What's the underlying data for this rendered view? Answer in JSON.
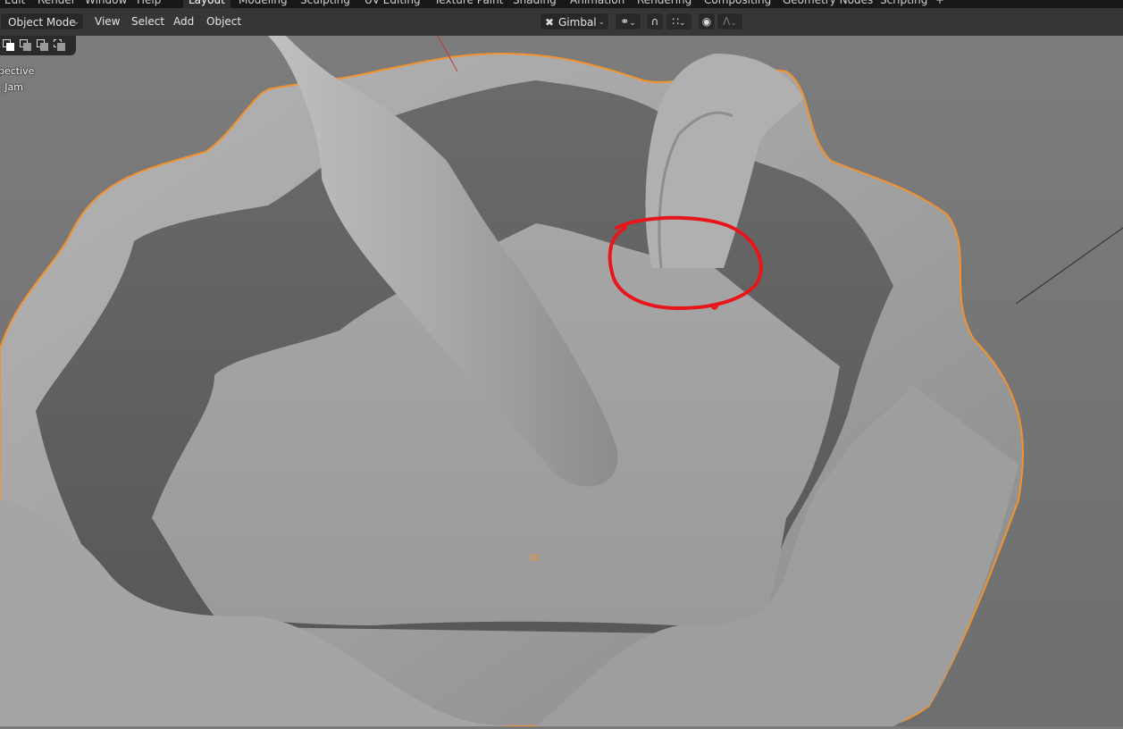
{
  "top_menu": [
    "Edit",
    "Render",
    "Window",
    "Help"
  ],
  "workspace_tabs": [
    {
      "label": "Layout",
      "active": true
    },
    {
      "label": "Modeling",
      "active": false
    },
    {
      "label": "Sculpting",
      "active": false
    },
    {
      "label": "UV Editing",
      "active": false
    },
    {
      "label": "Texture Paint",
      "active": false
    },
    {
      "label": "Shading",
      "active": false
    },
    {
      "label": "Animation",
      "active": false
    },
    {
      "label": "Rendering",
      "active": false
    },
    {
      "label": "Compositing",
      "active": false
    },
    {
      "label": "Geometry Nodes",
      "active": false
    },
    {
      "label": "Scripting",
      "active": false
    }
  ],
  "add_workspace_label": "+",
  "header": {
    "mode_label": "Object Mode",
    "menus": [
      "View",
      "Select",
      "Add",
      "Object"
    ],
    "transform_orientation": "Gimbal",
    "pivot_icon": "pivot-icon",
    "snap_icon": "magnet-icon",
    "snap_grid_icon": "grid-snap-icon",
    "proportional_icon": "proportional-edit-icon",
    "falloff_icon": "falloff-curve-icon"
  },
  "viewport_info": {
    "line1": "pective",
    "line2": "| Jam"
  },
  "colors": {
    "selection_outline": "#f4922e",
    "annotation": "#e8161b",
    "object_surface": "#9c9c9c",
    "background": "#787878"
  }
}
